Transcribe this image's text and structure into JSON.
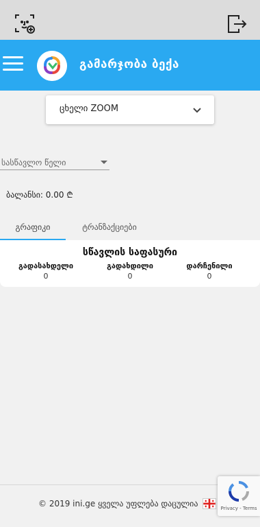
{
  "topbar": {
    "face_scan_icon": "face-scan-add-icon",
    "exit_icon": "logout-icon"
  },
  "appbar": {
    "menu_icon": "hamburger-icon",
    "greeting": "გამარჯობა  ბექა",
    "logo": "ini-logo"
  },
  "program_select": {
    "value": "ცხელი ZOOM"
  },
  "year_select": {
    "placeholder": "სასწავლო წელი"
  },
  "balance": {
    "text": "ბალანსი: 0.00 ₾"
  },
  "tabs": [
    {
      "label": "გრაფიკი",
      "active": true
    },
    {
      "label": "ტრანზაქციები",
      "active": false
    }
  ],
  "tuition": {
    "title": "სწავლის საფასური",
    "stats": [
      {
        "name": "გადასახდელი",
        "value": "0"
      },
      {
        "name": "გადახდილი",
        "value": "0"
      },
      {
        "name": "დარჩენილი",
        "value": "0"
      }
    ]
  },
  "footer": {
    "copyright": "© 2019 ini.ge ყველა უფლება დაცულია",
    "flag": "georgia-flag-icon"
  },
  "recaptcha": {
    "terms": "Privacy - Terms"
  },
  "colors": {
    "accent": "#2aa9f1",
    "topbar": "#dcdcdc",
    "background": "#f1f1f1"
  }
}
